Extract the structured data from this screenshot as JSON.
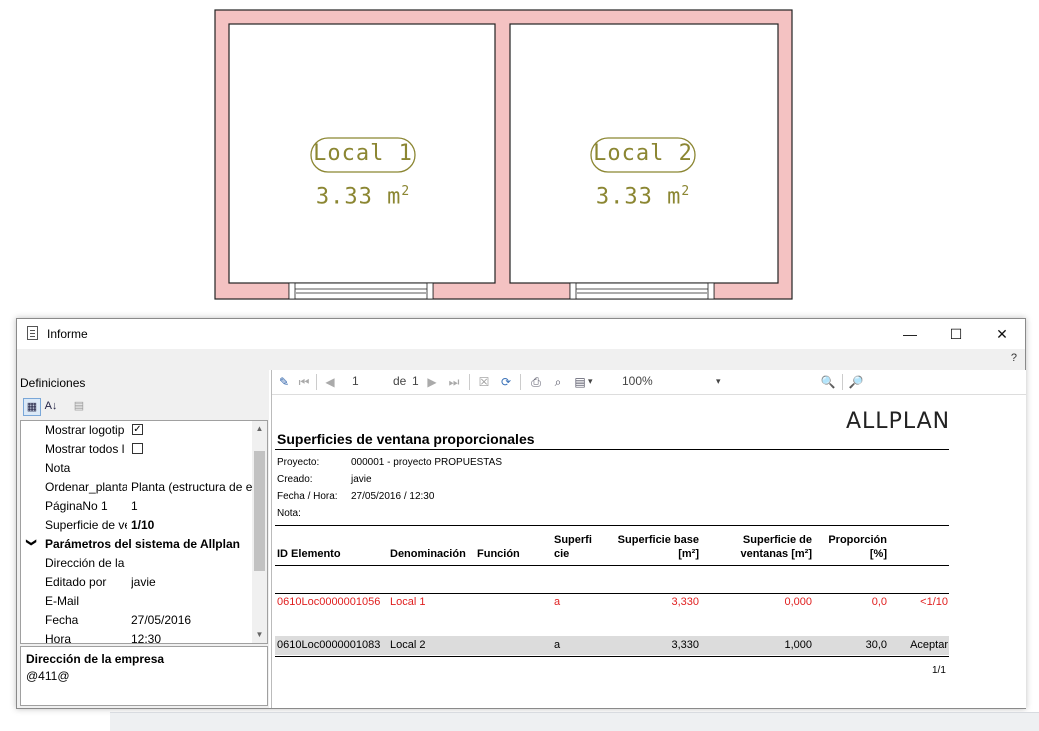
{
  "cad": {
    "rooms": [
      {
        "name": "Local 1",
        "area": "3.33 m",
        "sup": "2"
      },
      {
        "name": "Local 2",
        "area": "3.33 m",
        "sup": "2"
      }
    ],
    "colors": {
      "wall_fill": "#f4c2c2",
      "label": "#8b8632"
    }
  },
  "window": {
    "title": "Informe",
    "minimize": "—",
    "maximize": "☐",
    "close": "✕",
    "help": "?"
  },
  "left_panel": {
    "title": "Definiciones",
    "properties": [
      {
        "name": "Mostrar logotip",
        "checked": true
      },
      {
        "name": "Mostrar todos l",
        "checked": false
      },
      {
        "name": "Nota",
        "value": ""
      },
      {
        "name": "Ordenar_planta",
        "value": "Planta (estructura de ed"
      },
      {
        "name": "PáginaNo 1",
        "value": "1"
      },
      {
        "name": "Superficie de ve",
        "value": "1/10"
      }
    ],
    "group": {
      "expander": "❯",
      "label": "Parámetros del sistema de Allplan"
    },
    "system_properties": [
      {
        "name": "Dirección de la",
        "value": ""
      },
      {
        "name": "Editado por",
        "value": "javie"
      },
      {
        "name": "E-Mail",
        "value": ""
      },
      {
        "name": "Fecha",
        "value": "27/05/2016"
      },
      {
        "name": "Hora",
        "value": "12:30"
      }
    ],
    "description": {
      "title": "Dirección de la empresa",
      "text": "@411@"
    }
  },
  "viewer_toolbar": {
    "page": "1",
    "of_label": "de",
    "total_pages": "1",
    "zoom": "100%",
    "dropdown": "▾"
  },
  "report": {
    "logo": "ALLPLAN",
    "title": "Superficies de ventana proporcionales",
    "meta": [
      {
        "label": "Proyecto:",
        "value": "000001 - proyecto PROPUESTAS"
      },
      {
        "label": "Creado:",
        "value": "javie"
      },
      {
        "label": "Fecha / Hora:",
        "value": "27/05/2016  /  12:30"
      },
      {
        "label": "Nota:",
        "value": ""
      }
    ],
    "columns": {
      "id": "ID Elemento",
      "denominacion": "Denominación",
      "funcion": "Función",
      "superficie_1": "Superfi",
      "superficie_2": "cie",
      "base_1": "Superficie base",
      "base_2": "[m²]",
      "ventanas_1": "Superficie de",
      "ventanas_2": "ventanas [m²]",
      "proporcion_1": "Proporción",
      "proporcion_2": "[%]"
    },
    "rows": [
      {
        "id": "0610Loc0000001056",
        "denominacion": "Local 1",
        "funcion": "",
        "superficie": "a",
        "base": "3,330",
        "ventanas": "0,000",
        "proporcion": "0,0",
        "estado": "<1/10",
        "highlight": "red"
      },
      {
        "id": "0610Loc0000001083",
        "denominacion": "Local 2",
        "funcion": "",
        "superficie": "a",
        "base": "3,330",
        "ventanas": "1,000",
        "proporcion": "30,0",
        "estado": "Aceptar",
        "highlight": "gray"
      }
    ],
    "page_indicator": "1/1"
  }
}
